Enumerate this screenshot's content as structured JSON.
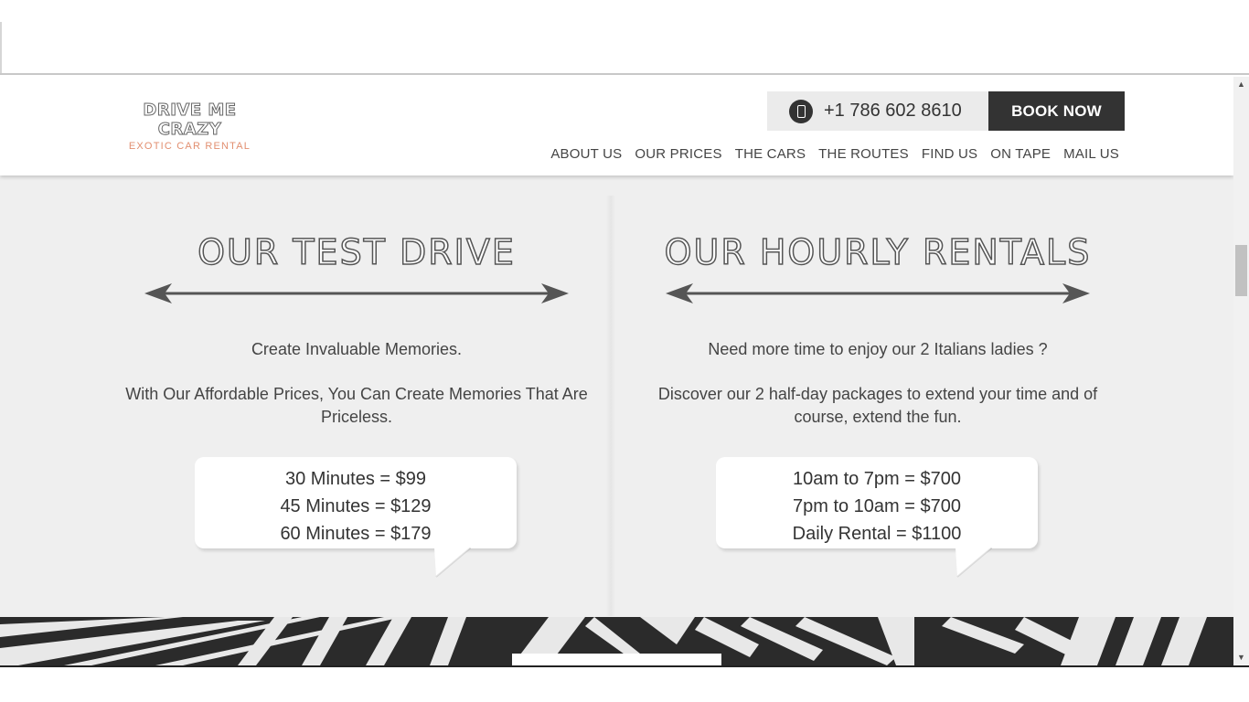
{
  "header": {
    "logo_main": "DRIVE ME CRAZY",
    "logo_sub": "EXOTIC CAR RENTAL",
    "phone": "+1 786 602 8610",
    "book_label": "BOOK NOW",
    "nav": [
      "ABOUT US",
      "OUR PRICES",
      "THE CARS",
      "THE ROUTES",
      "FIND US",
      "ON TAPE",
      "MAIL US"
    ]
  },
  "test_drive": {
    "title": "OUR TEST DRIVE",
    "tagline": "Create Invaluable Memories.",
    "description": "With Our Affordable Prices, You Can Create Memories That Are Priceless.",
    "prices": [
      "30 Minutes = $99",
      "45 Minutes = $129",
      "60 Minutes = $179"
    ]
  },
  "hourly": {
    "title": "OUR HOURLY RENTALS",
    "tagline": "Need more time to enjoy our 2 Italians ladies ?",
    "description": "Discover our 2 half-day packages to extend your time and of course, extend the fun.",
    "prices": [
      "10am to 7pm = $700",
      "7pm to 10am = $700",
      "Daily Rental = $1100"
    ]
  },
  "colors": {
    "accent": "#e28f70",
    "dark": "#333333",
    "section_bg": "#efefef"
  },
  "icons": {
    "phone": "mobile-phone-icon",
    "arrow": "double-arrow-icon"
  }
}
